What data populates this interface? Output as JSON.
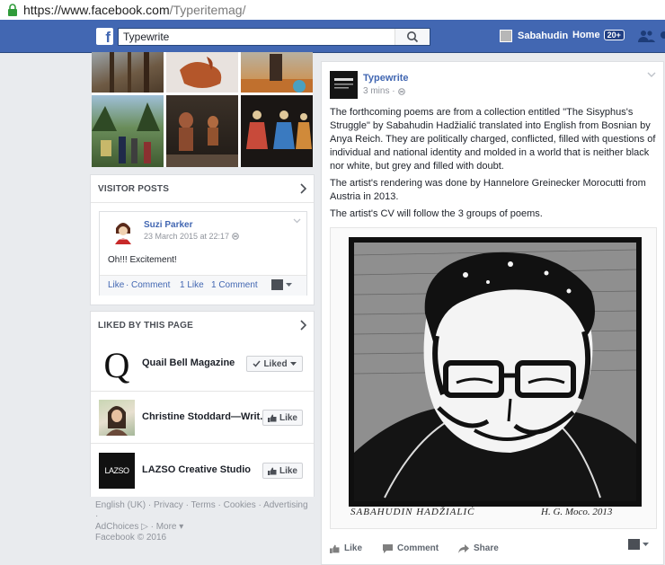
{
  "browser": {
    "url_host": "https://www.facebook.com",
    "url_path": "/Typeritemag/"
  },
  "topbar": {
    "search_value": "Typewrite",
    "user_name": "Sabahudin",
    "home_label": "Home",
    "home_count": "20+"
  },
  "visitor_posts": {
    "header": "VISITOR POSTS",
    "post": {
      "author": "Suzi Parker",
      "time": "23 March 2015 at 22:17",
      "text": "Oh!!! Excitement!",
      "like": "Like",
      "comment": "Comment",
      "likes_count": "1 Like",
      "comments_count": "1 Comment"
    }
  },
  "liked_by_page": {
    "header": "LIKED BY THIS PAGE",
    "pages": [
      {
        "name": "Quail Bell Magazine",
        "button": "Liked",
        "thumb_letter": "Q"
      },
      {
        "name": "Christine Stoddard—Writ...",
        "button": "Like"
      },
      {
        "name": "LAZSO Creative Studio",
        "button": "Like",
        "thumb_letter": "LAZSO"
      }
    ]
  },
  "footer": {
    "line1": "English (UK) · Privacy · Terms · Cookies · Advertising ·",
    "line2": "AdChoices ▷ · More ▾",
    "copyright": "Facebook © 2016"
  },
  "main_post": {
    "page_name": "Typewrite",
    "time": "3 mins ·",
    "paragraphs": [
      "The forthcoming poems are from a collection entitled \"The Sisyphus's Struggle\" by Sabahudin Hadžialić translated into English from Bosnian by Anya Reich. They are politically charged, conflicted, filled with questions of individual and national identity and molded in a world that is neither black nor white, but grey and filled with doubt.",
      "The artist's rendering was done by Hannelore Greinecker Morocutti from Austria in 2013.",
      "The artist's CV will follow the 3 groups of poems."
    ],
    "image_caption": "SABAHUDIN HADŽIALIĆ",
    "image_signature": "H. G. Moco. 2013",
    "actions": {
      "like": "Like",
      "comment": "Comment",
      "share": "Share"
    }
  },
  "colors": {
    "fb_blue": "#4267b2",
    "link": "#4267b2",
    "background": "#e9ebee"
  }
}
